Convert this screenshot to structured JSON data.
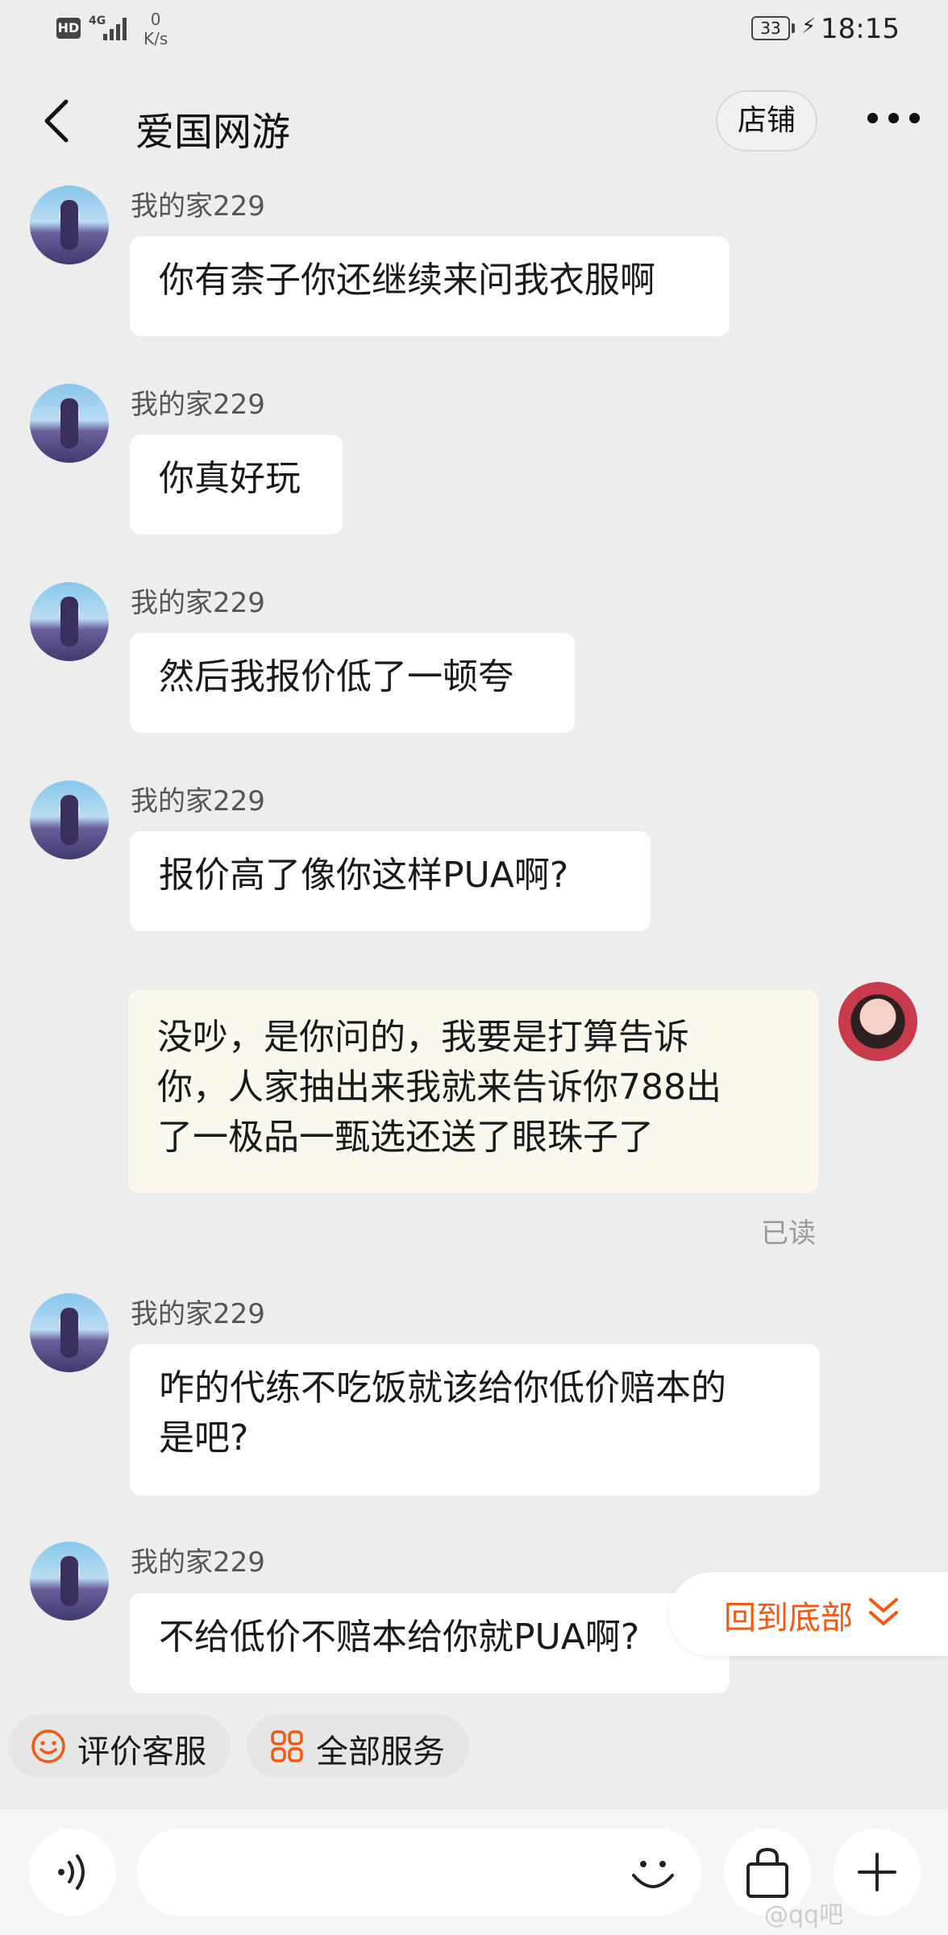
{
  "status_bar": {
    "hd": "HD",
    "network_type": "4G",
    "net_speed_value": "0",
    "net_speed_unit": "K/s",
    "battery": "33",
    "time": "18:15"
  },
  "header": {
    "title": "爱国网游",
    "shop_button": "店铺"
  },
  "messages": [
    {
      "from": "other",
      "sender": "我的家229",
      "text": "你有柰子你还继续来问我衣服啊"
    },
    {
      "from": "other",
      "sender": "我的家229",
      "text": "你真好玩"
    },
    {
      "from": "other",
      "sender": "我的家229",
      "text": "然后我报价低了一顿夸"
    },
    {
      "from": "other",
      "sender": "我的家229",
      "text": "报价高了像你这样PUA啊?"
    },
    {
      "from": "me",
      "lines": [
        "没吵，是你问的，我要是打算告诉",
        "你，人家抽出来我就来告诉你788出",
        "了一极品一甄选还送了眼珠子了"
      ],
      "status": "已读"
    },
    {
      "from": "other",
      "sender": "我的家229",
      "lines": [
        "咋的代练不吃饭就该给你低价赔本的",
        "是吧?"
      ]
    },
    {
      "from": "other",
      "sender": "我的家229",
      "text": "不给低价不赔本给你就PUA啊?"
    }
  ],
  "back_to_bottom": "回到底部",
  "quick_actions": [
    {
      "label": "评价客服",
      "icon": "smiley-icon"
    },
    {
      "label": "全部服务",
      "icon": "grid-icon"
    }
  ],
  "input": {
    "placeholder": "",
    "voice_icon": "voice-icon",
    "emoji_icon": "emoji-icon",
    "bag_icon": "shopping-bag-icon",
    "plus_icon": "plus-icon"
  },
  "watermark": "@qq吧",
  "colors": {
    "accent": "#f05a14",
    "background": "#ededed",
    "bubble_other": "#ffffff",
    "bubble_me": "#fdf8ee"
  }
}
